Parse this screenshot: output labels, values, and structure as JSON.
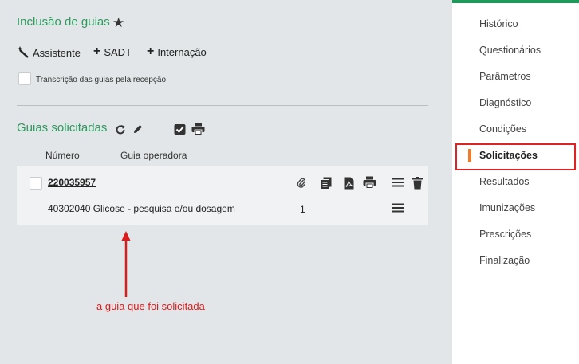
{
  "header": {
    "title": "Inclusão de guias"
  },
  "toolbar": {
    "assistente": "Assistente",
    "sadt": "SADT",
    "internacao": "Internação"
  },
  "transcricao_label": "Transcrição das guias pela recepção",
  "guias": {
    "title": "Guias solicitadas",
    "col_numero": "Número",
    "col_operadora": "Guia operadora",
    "items": [
      {
        "numero": "220035957",
        "procedure": "40302040 Glicose - pesquisa e/ou dosagem",
        "qty": "1"
      }
    ]
  },
  "annotation": "a guia que foi solicitada",
  "sidebar": {
    "items": [
      {
        "label": "Histórico"
      },
      {
        "label": "Questionários"
      },
      {
        "label": "Parâmetros"
      },
      {
        "label": "Diagnóstico"
      },
      {
        "label": "Condições"
      },
      {
        "label": "Solicitações"
      },
      {
        "label": "Resultados"
      },
      {
        "label": "Imunizações"
      },
      {
        "label": "Prescrições"
      },
      {
        "label": "Finalização"
      }
    ],
    "active_index": 5
  },
  "colors": {
    "accent": "#2e9a5e",
    "active_marker": "#f07b2b",
    "highlight_box": "#e02222",
    "annotation": "#d91c1c"
  },
  "icons": [
    "star-icon",
    "magic-wand-icon",
    "plus-icon",
    "refresh-icon",
    "pencil-icon",
    "check-square-icon",
    "print-icon",
    "paperclip-icon",
    "copy-icon",
    "pdf-icon",
    "menu-icon",
    "trash-icon"
  ]
}
